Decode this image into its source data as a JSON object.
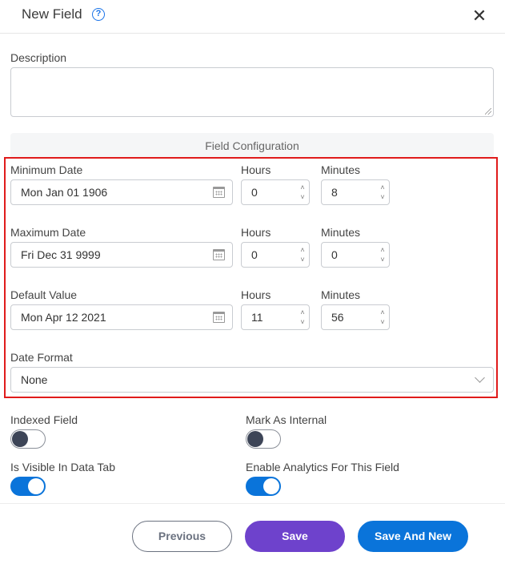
{
  "header": {
    "title": "New Field",
    "help_icon": "?",
    "close_icon": "✕"
  },
  "description": {
    "label": "Description",
    "value": ""
  },
  "field_configuration": {
    "title": "Field Configuration",
    "rows": [
      {
        "label": "Minimum Date",
        "date": "Mon Jan 01 1906",
        "hours_label": "Hours",
        "hours": "0",
        "minutes_label": "Minutes",
        "minutes": "8"
      },
      {
        "label": "Maximum Date",
        "date": "Fri Dec 31 9999",
        "hours_label": "Hours",
        "hours": "0",
        "minutes_label": "Minutes",
        "minutes": "0"
      },
      {
        "label": "Default Value",
        "date": "Mon Apr 12 2021",
        "hours_label": "Hours",
        "hours": "11",
        "minutes_label": "Minutes",
        "minutes": "56"
      }
    ],
    "date_format": {
      "label": "Date Format",
      "selected": "None"
    }
  },
  "toggles": [
    {
      "label": "Indexed Field",
      "on": false
    },
    {
      "label": "Mark As Internal",
      "on": false
    },
    {
      "label": "Is Visible In Data Tab",
      "on": true
    },
    {
      "label": "Enable Analytics For This Field",
      "on": true
    }
  ],
  "spinner": {
    "up": "˄",
    "down": "˅"
  },
  "footer": {
    "previous": "Previous",
    "save": "Save",
    "save_and_new": "Save And New"
  },
  "colors": {
    "accent_blue": "#0a74da",
    "save_purple": "#6e42cc",
    "highlight_red": "#e01b1b"
  }
}
